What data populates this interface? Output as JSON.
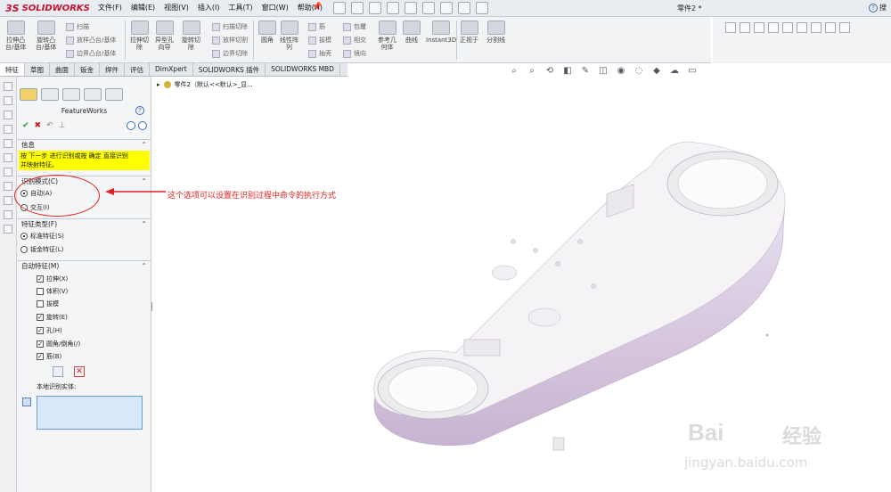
{
  "app": {
    "brand_prefix": "3S",
    "brand_name": "SOLIDWORKS",
    "doc_title": "零件2 *",
    "help_label": "搜"
  },
  "menu": [
    "文件(F)",
    "编辑(E)",
    "视图(V)",
    "插入(I)",
    "工具(T)",
    "窗口(W)",
    "帮助(H)"
  ],
  "ribbon": {
    "extrude_boss": "拉伸凸\n台/基体",
    "revolve_boss": "旋转凸\n台/基体",
    "sweep": "扫描",
    "loft": "放样凸台/基体",
    "boundary": "边界凸台/基体",
    "extrude_cut": "拉伸切\n除",
    "hole_wizard": "异型孔\n向导",
    "revolve_cut": "旋转切\n除",
    "swept_cut": "扫描切除",
    "lofted_cut": "放样切割",
    "boundary_cut": "边界切除",
    "fillet": "圆角",
    "linear_pattern": "线性阵\n列",
    "rib": "筋",
    "draft": "拔模",
    "shell": "抽壳",
    "wrap": "包覆",
    "intersect": "相交",
    "mirror": "镜向",
    "ref_geometry": "参考几\n何体",
    "curves": "曲线",
    "instant3d": "Instant3D",
    "normal_to": "正视于",
    "split_line": "分割线"
  },
  "tabs": [
    "特征",
    "草图",
    "曲面",
    "钣金",
    "焊件",
    "评估",
    "DimXpert",
    "SOLIDWORKS 插件",
    "SOLIDWORKS MBD"
  ],
  "active_tab": "特征",
  "panel": {
    "title": "FeatureWorks",
    "help": "?",
    "info_header": "信息",
    "info_text_1": "按 下一步 进行识别或按 确定 直接识别",
    "info_text_2": "并映射特征。",
    "mode_header": "识别模式(C)",
    "mode_auto": "自动(A)",
    "mode_interactive": "交互(I)",
    "type_header": "特征类型(F)",
    "type_standard": "标准特征(S)",
    "type_sheetmetal": "钣金特征(L)",
    "auto_header": "自动特征(M)",
    "auto_items": [
      {
        "label": "拉伸(X)",
        "checked": true
      },
      {
        "label": "体积(V)",
        "checked": false
      },
      {
        "label": "拔模",
        "checked": false
      },
      {
        "label": "旋转(E)",
        "checked": true
      },
      {
        "label": "孔(H)",
        "checked": true
      },
      {
        "label": "圆角/倒角(/)",
        "checked": true
      },
      {
        "label": "筋(B)",
        "checked": true
      }
    ],
    "local_bodies": "本地识别实体:"
  },
  "annotation": "这个选项可以设置在识别过程中命令的执行方式",
  "tree": {
    "item": "零件2（默认<<默认>_显..."
  },
  "watermark": {
    "brand": "Bai",
    "brand_cn": "经验",
    "url": "jingyan.baidu.com"
  },
  "colors": {
    "highlight": "#ffff00",
    "annotation": "#e02020",
    "model_body": "#f3eef4"
  }
}
